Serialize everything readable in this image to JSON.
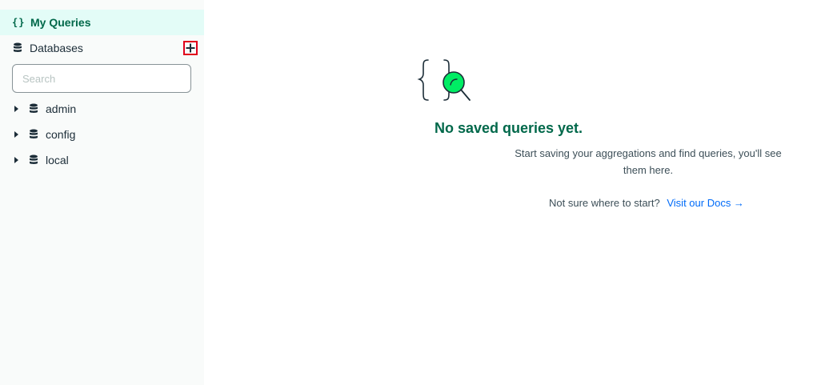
{
  "sidebar": {
    "my_queries_label": "My Queries",
    "databases_label": "Databases",
    "search_placeholder": "Search",
    "databases": [
      {
        "name": "admin"
      },
      {
        "name": "config"
      },
      {
        "name": "local"
      }
    ]
  },
  "main": {
    "empty_title": "No saved queries yet.",
    "empty_description": "Start saving your aggregations and find queries, you'll see them here.",
    "help_text": "Not sure where to start?",
    "docs_link": "Visit our Docs →"
  },
  "colors": {
    "accent": "#00684a",
    "active_bg": "#e3fcf7",
    "sidebar_bg": "#f9fbfa",
    "link": "#016bf8",
    "highlight_border": "#e0001b",
    "illustration_green": "#00ed64"
  },
  "icons": {
    "my_queries": "braces-icon",
    "databases": "database-icon",
    "add": "plus-icon",
    "expand": "caret-right-icon",
    "empty_state": "braces-magnifier-icon"
  }
}
